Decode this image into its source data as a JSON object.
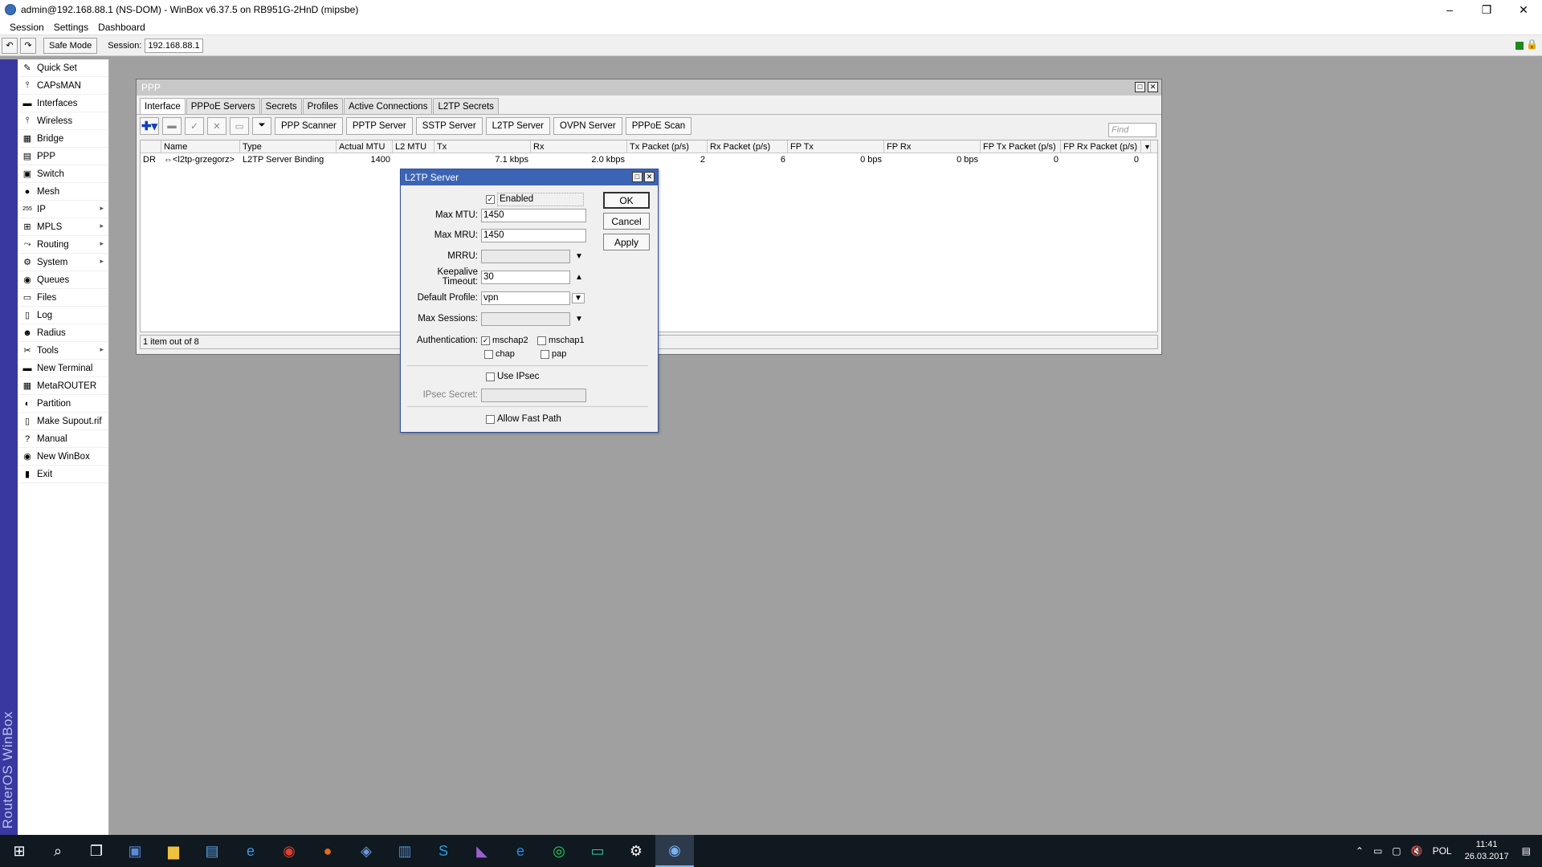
{
  "window": {
    "title": "admin@192.168.88.1 (NS-DOM) - WinBox v6.37.5 on RB951G-2HnD (mipsbe)",
    "controls": [
      "–",
      "❐",
      "✕"
    ]
  },
  "menu": [
    "Session",
    "Settings",
    "Dashboard"
  ],
  "toolbar": {
    "safe_mode": "Safe Mode",
    "session_label": "Session:",
    "session_value": "192.168.88.1"
  },
  "brand": "RouterOS WinBox",
  "sidebar": [
    {
      "label": "Quick Set",
      "icon": "quick-set-icon",
      "glyph": "✎",
      "arrow": false
    },
    {
      "label": "CAPsMAN",
      "icon": "capsman-icon",
      "glyph": "⫯",
      "arrow": false
    },
    {
      "label": "Interfaces",
      "icon": "interfaces-icon",
      "glyph": "▬",
      "arrow": false
    },
    {
      "label": "Wireless",
      "icon": "wireless-icon",
      "glyph": "⫯",
      "arrow": false
    },
    {
      "label": "Bridge",
      "icon": "bridge-icon",
      "glyph": "▦",
      "arrow": false
    },
    {
      "label": "PPP",
      "icon": "ppp-icon",
      "glyph": "▤",
      "arrow": false
    },
    {
      "label": "Switch",
      "icon": "switch-icon",
      "glyph": "▣",
      "arrow": false
    },
    {
      "label": "Mesh",
      "icon": "mesh-icon",
      "glyph": "●",
      "arrow": false
    },
    {
      "label": "IP",
      "icon": "ip-icon",
      "glyph": "255",
      "arrow": true
    },
    {
      "label": "MPLS",
      "icon": "mpls-icon",
      "glyph": "⊞",
      "arrow": true
    },
    {
      "label": "Routing",
      "icon": "routing-icon",
      "glyph": "⤳",
      "arrow": true
    },
    {
      "label": "System",
      "icon": "system-icon",
      "glyph": "⚙",
      "arrow": true
    },
    {
      "label": "Queues",
      "icon": "queues-icon",
      "glyph": "◉",
      "arrow": false
    },
    {
      "label": "Files",
      "icon": "files-icon",
      "glyph": "▭",
      "arrow": false
    },
    {
      "label": "Log",
      "icon": "log-icon",
      "glyph": "▯",
      "arrow": false
    },
    {
      "label": "Radius",
      "icon": "radius-icon",
      "glyph": "☻",
      "arrow": false
    },
    {
      "label": "Tools",
      "icon": "tools-icon",
      "glyph": "✂",
      "arrow": true
    },
    {
      "label": "New Terminal",
      "icon": "terminal-icon",
      "glyph": "▬",
      "arrow": false
    },
    {
      "label": "MetaROUTER",
      "icon": "metarouter-icon",
      "glyph": "▦",
      "arrow": false
    },
    {
      "label": "Partition",
      "icon": "partition-icon",
      "glyph": "◐",
      "arrow": false
    },
    {
      "label": "Make Supout.rif",
      "icon": "supout-icon",
      "glyph": "▯",
      "arrow": false
    },
    {
      "label": "Manual",
      "icon": "manual-icon",
      "glyph": "?",
      "arrow": false
    },
    {
      "label": "New WinBox",
      "icon": "winbox-icon",
      "glyph": "◉",
      "arrow": false
    },
    {
      "label": "Exit",
      "icon": "exit-icon",
      "glyph": "▮",
      "arrow": false
    }
  ],
  "ppp": {
    "title": "PPP",
    "tabs": [
      "Interface",
      "PPPoE Servers",
      "Secrets",
      "Profiles",
      "Active Connections",
      "L2TP Secrets"
    ],
    "buttons": [
      "PPP Scanner",
      "PPTP Server",
      "SSTP Server",
      "L2TP Server",
      "OVPN Server",
      "PPPoE Scan"
    ],
    "find_placeholder": "Find",
    "columns": [
      "",
      "Name",
      "Type",
      "Actual MTU",
      "L2 MTU",
      "Tx",
      "Rx",
      "Tx Packet (p/s)",
      "Rx Packet (p/s)",
      "FP Tx",
      "FP Rx",
      "FP Tx Packet (p/s)",
      "FP Rx Packet (p/s)"
    ],
    "rows": [
      [
        "DR",
        "⇔<l2tp-grzegorz>",
        "L2TP Server Binding",
        "1400",
        "",
        "7.1 kbps",
        "2.0 kbps",
        "2",
        "6",
        "0 bps",
        "0 bps",
        "0",
        "0"
      ]
    ],
    "status": "1 item out of 8"
  },
  "l2tp": {
    "title": "L2TP Server",
    "enabled_label": "Enabled",
    "enabled": true,
    "max_mtu_label": "Max MTU:",
    "max_mtu": "1450",
    "max_mru_label": "Max MRU:",
    "max_mru": "1450",
    "mrru_label": "MRRU:",
    "mrru": "",
    "keepalive_label": "Keepalive Timeout:",
    "keepalive": "30",
    "profile_label": "Default Profile:",
    "profile": "vpn",
    "max_sessions_label": "Max Sessions:",
    "max_sessions": "",
    "auth_label": "Authentication:",
    "auth": {
      "mschap2": true,
      "mschap1": false,
      "chap": false,
      "pap": false
    },
    "auth_labels": {
      "mschap2": "mschap2",
      "mschap1": "mschap1",
      "chap": "chap",
      "pap": "pap"
    },
    "use_ipsec_label": "Use IPsec",
    "ipsec_secret_label": "IPsec Secret:",
    "ipsec_secret": "",
    "fast_path_label": "Allow Fast Path",
    "ok": "OK",
    "cancel": "Cancel",
    "apply": "Apply"
  },
  "taskbar": {
    "lang": "POL",
    "time": "11:41",
    "date": "26.03.2017"
  }
}
